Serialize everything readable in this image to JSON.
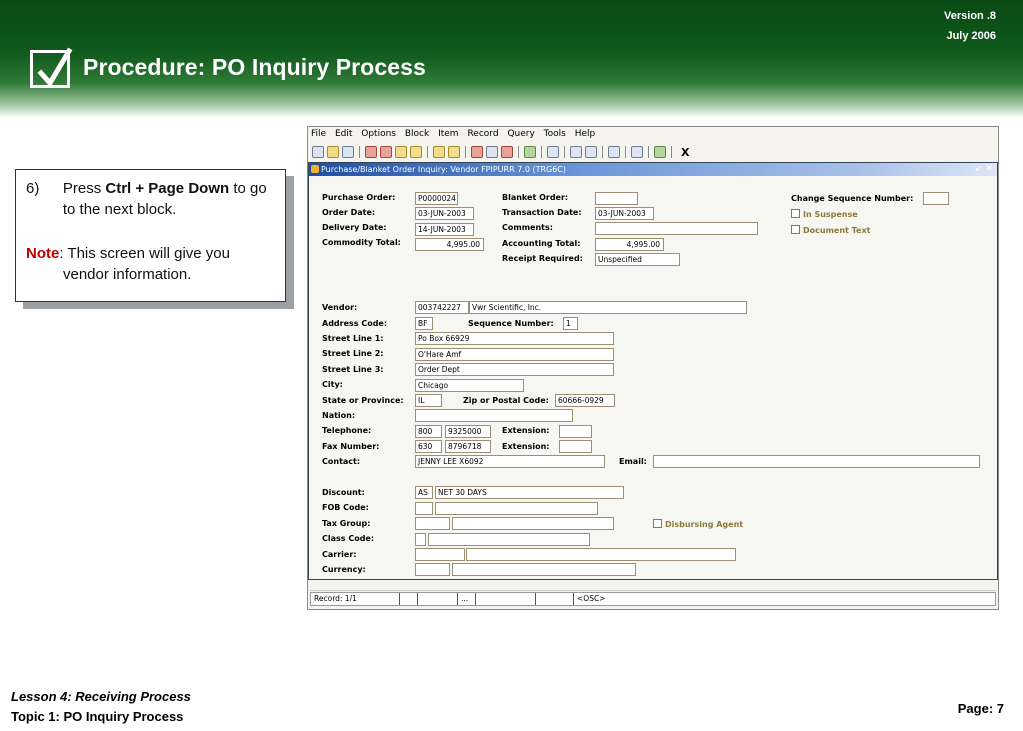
{
  "header": {
    "version": "Version .8",
    "date": "July  2006",
    "title": "Procedure: PO Inquiry Process"
  },
  "note": {
    "step_number": "6)",
    "step_pre": "Press ",
    "step_bold": "Ctrl + Page Down",
    "step_post": " to go to the next block.",
    "note_label": "Note",
    "note_text": ":  This screen will give you vendor information."
  },
  "window": {
    "menu": [
      "File",
      "Edit",
      "Options",
      "Block",
      "Item",
      "Record",
      "Query",
      "Tools",
      "Help"
    ],
    "toolbar_exit": "X",
    "form_title": "Purchase/Blanket Order Inquiry: Vendor  FPIPURR  7.0  (TRG6C)",
    "form_controls": "↙ ✕"
  },
  "form": {
    "purchase_order": {
      "label": "Purchase Order:",
      "value": "P0000024"
    },
    "order_date": {
      "label": "Order Date:",
      "value": "03-JUN-2003"
    },
    "delivery_date": {
      "label": "Delivery Date:",
      "value": "14-JUN-2003"
    },
    "commodity_total": {
      "label": "Commodity Total:",
      "value": "4,995.00"
    },
    "blanket_order": {
      "label": "Blanket Order:",
      "value": ""
    },
    "transaction_date": {
      "label": "Transaction Date:",
      "value": "03-JUN-2003"
    },
    "comments": {
      "label": "Comments:",
      "value": ""
    },
    "accounting_total": {
      "label": "Accounting Total:",
      "value": "4,995.00"
    },
    "receipt_required": {
      "label": "Receipt Required:",
      "value": "Unspecified"
    },
    "change_sequence": {
      "label": "Change Sequence Number:",
      "value": ""
    },
    "in_suspense": {
      "label": "In Suspense"
    },
    "document_text": {
      "label": "Document Text"
    },
    "vendor": {
      "label": "Vendor:",
      "id": "003742227",
      "name": "Vwr Scientific, Inc."
    },
    "address_code": {
      "label": "Address Code:",
      "value": "BF"
    },
    "sequence_number": {
      "label": "Sequence Number:",
      "value": "1"
    },
    "street1": {
      "label": "Street Line 1:",
      "value": "Po Box 66929"
    },
    "street2": {
      "label": "Street Line 2:",
      "value": "O'Hare Amf"
    },
    "street3": {
      "label": "Street Line 3:",
      "value": "Order Dept"
    },
    "city": {
      "label": "City:",
      "value": "Chicago"
    },
    "state": {
      "label": "State or Province:",
      "value": "IL"
    },
    "zip": {
      "label": "Zip or Postal Code:",
      "value": "60666-0929"
    },
    "nation": {
      "label": "Nation:",
      "value": ""
    },
    "telephone": {
      "label": "Telephone:",
      "area": "800",
      "number": "9325000"
    },
    "tel_ext": {
      "label": "Extension:",
      "value": ""
    },
    "fax": {
      "label": "Fax Number:",
      "area": "630",
      "number": "8796718"
    },
    "fax_ext": {
      "label": "Extension:",
      "value": ""
    },
    "contact": {
      "label": "Contact:",
      "value": "JENNY LEE X6092"
    },
    "email": {
      "label": "Email:",
      "value": ""
    },
    "discount": {
      "label": "Discount:",
      "code": "AS",
      "desc": "NET 30 DAYS"
    },
    "fob_code": {
      "label": "FOB Code:"
    },
    "tax_group": {
      "label": "Tax Group:"
    },
    "disbursing_agent": {
      "label": "Disbursing Agent"
    },
    "class_code": {
      "label": "Class Code:"
    },
    "carrier": {
      "label": "Carrier:"
    },
    "currency": {
      "label": "Currency:"
    }
  },
  "statusbar": {
    "record": "Record: 1/1",
    "ellipsis": "...",
    "osc": "<OSC>"
  },
  "footer": {
    "lesson": "Lesson 4: Receiving Process",
    "topic": "Topic 1: PO Inquiry Process",
    "page": "Page: 7"
  }
}
